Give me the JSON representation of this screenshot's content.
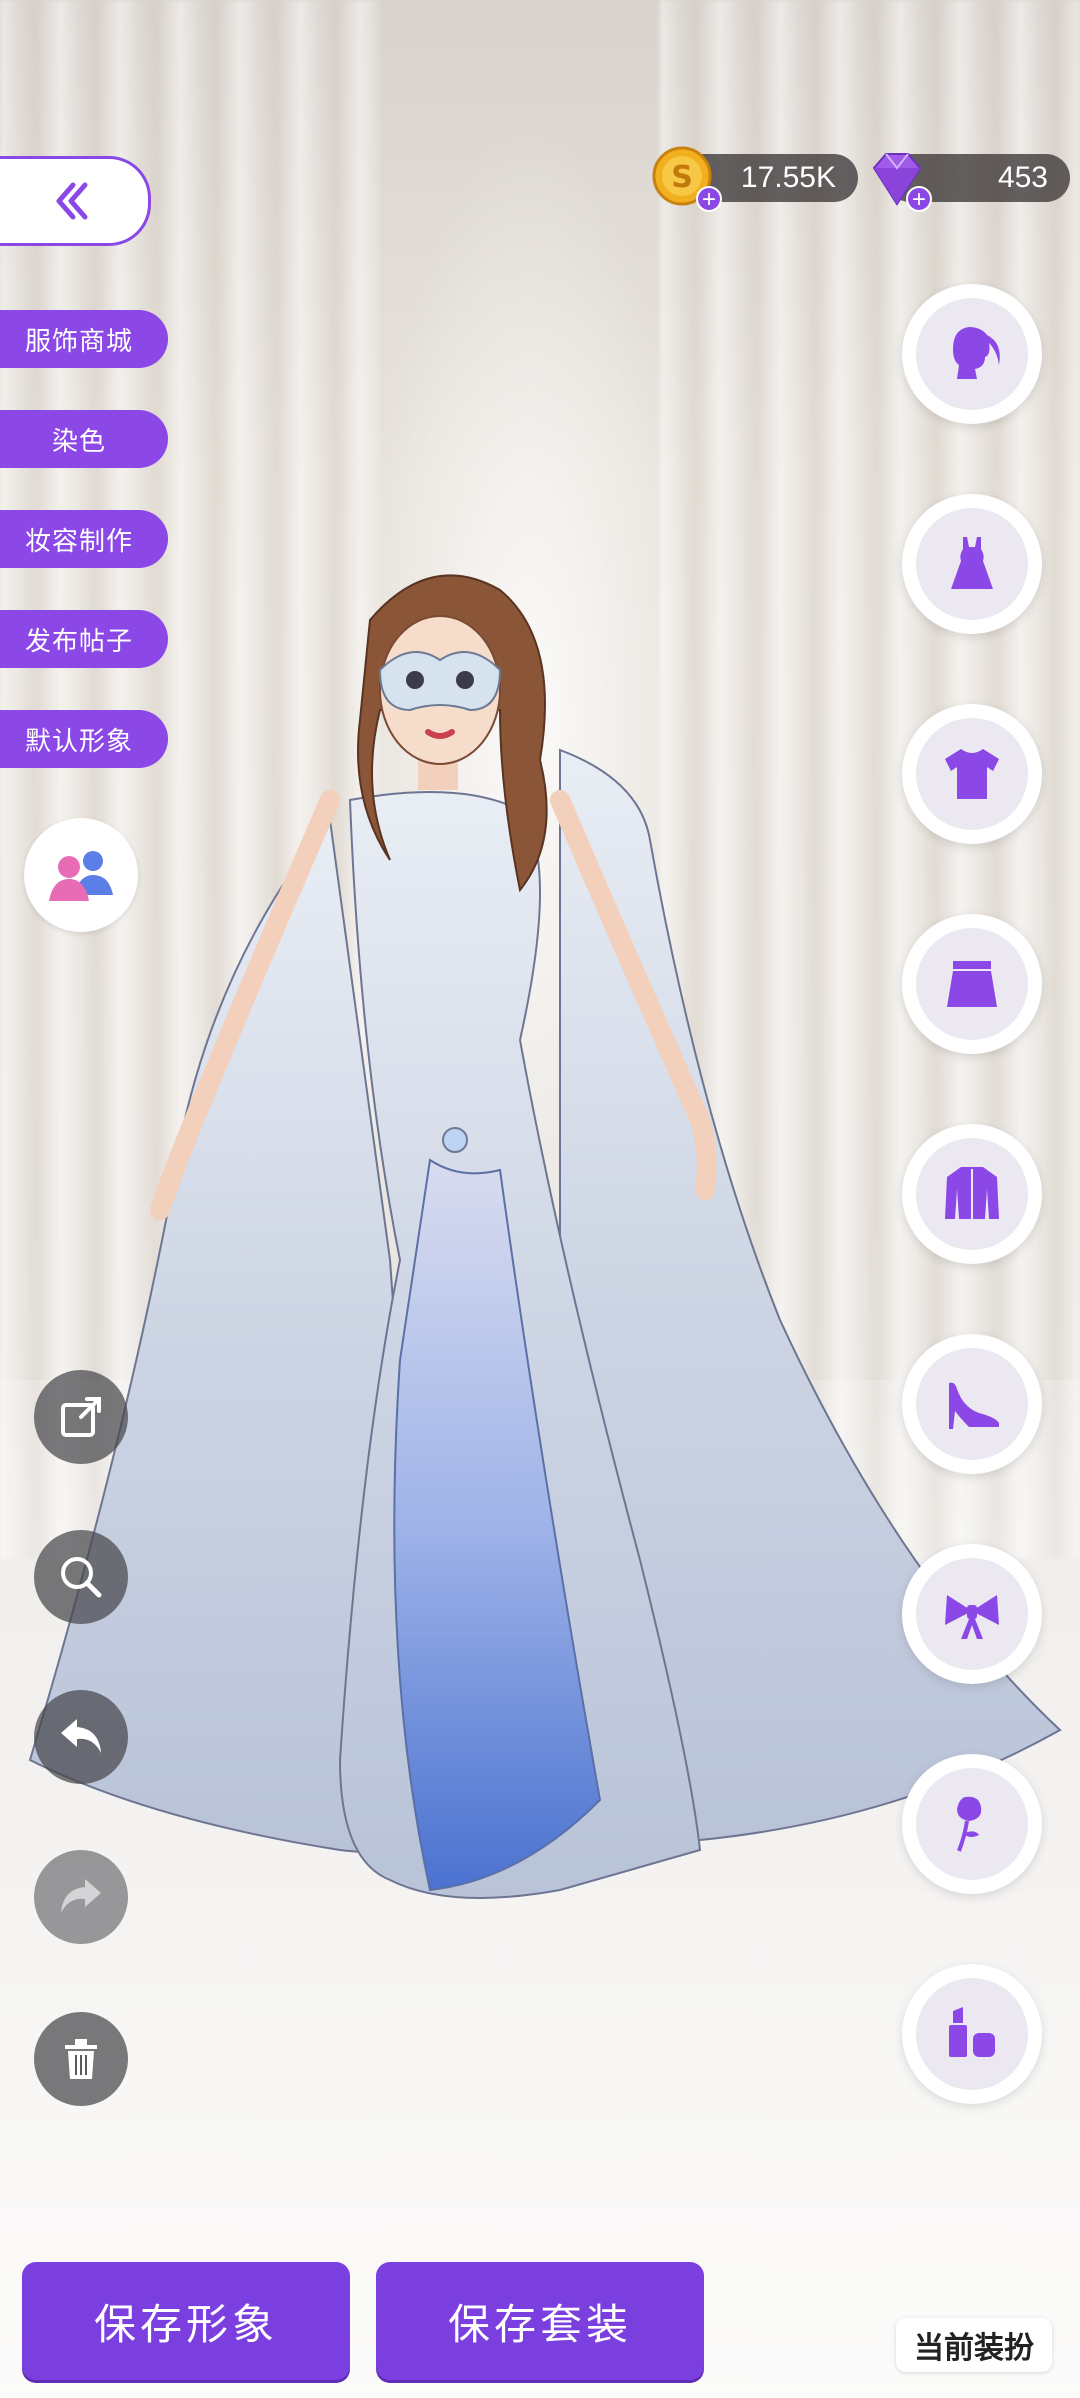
{
  "currency": {
    "coins": "17.55K",
    "gems": "453"
  },
  "menu": [
    "服饰商城",
    "染色",
    "妆容制作",
    "发布帖子",
    "默认形象"
  ],
  "categories": [
    "hair-icon",
    "dress-icon",
    "top-icon",
    "skirt-icon",
    "coat-icon",
    "shoes-icon",
    "bow-icon",
    "rose-icon",
    "makeup-icon"
  ],
  "tools": [
    "share-icon",
    "zoom-icon",
    "undo-icon",
    "redo-icon",
    "trash-icon"
  ],
  "buttons": {
    "save_look": "保存形象",
    "save_outfit": "保存套装"
  },
  "current_outfit_label": "当前装扮",
  "colors": {
    "accent": "#8b48e6",
    "button": "#7b3fe0"
  }
}
